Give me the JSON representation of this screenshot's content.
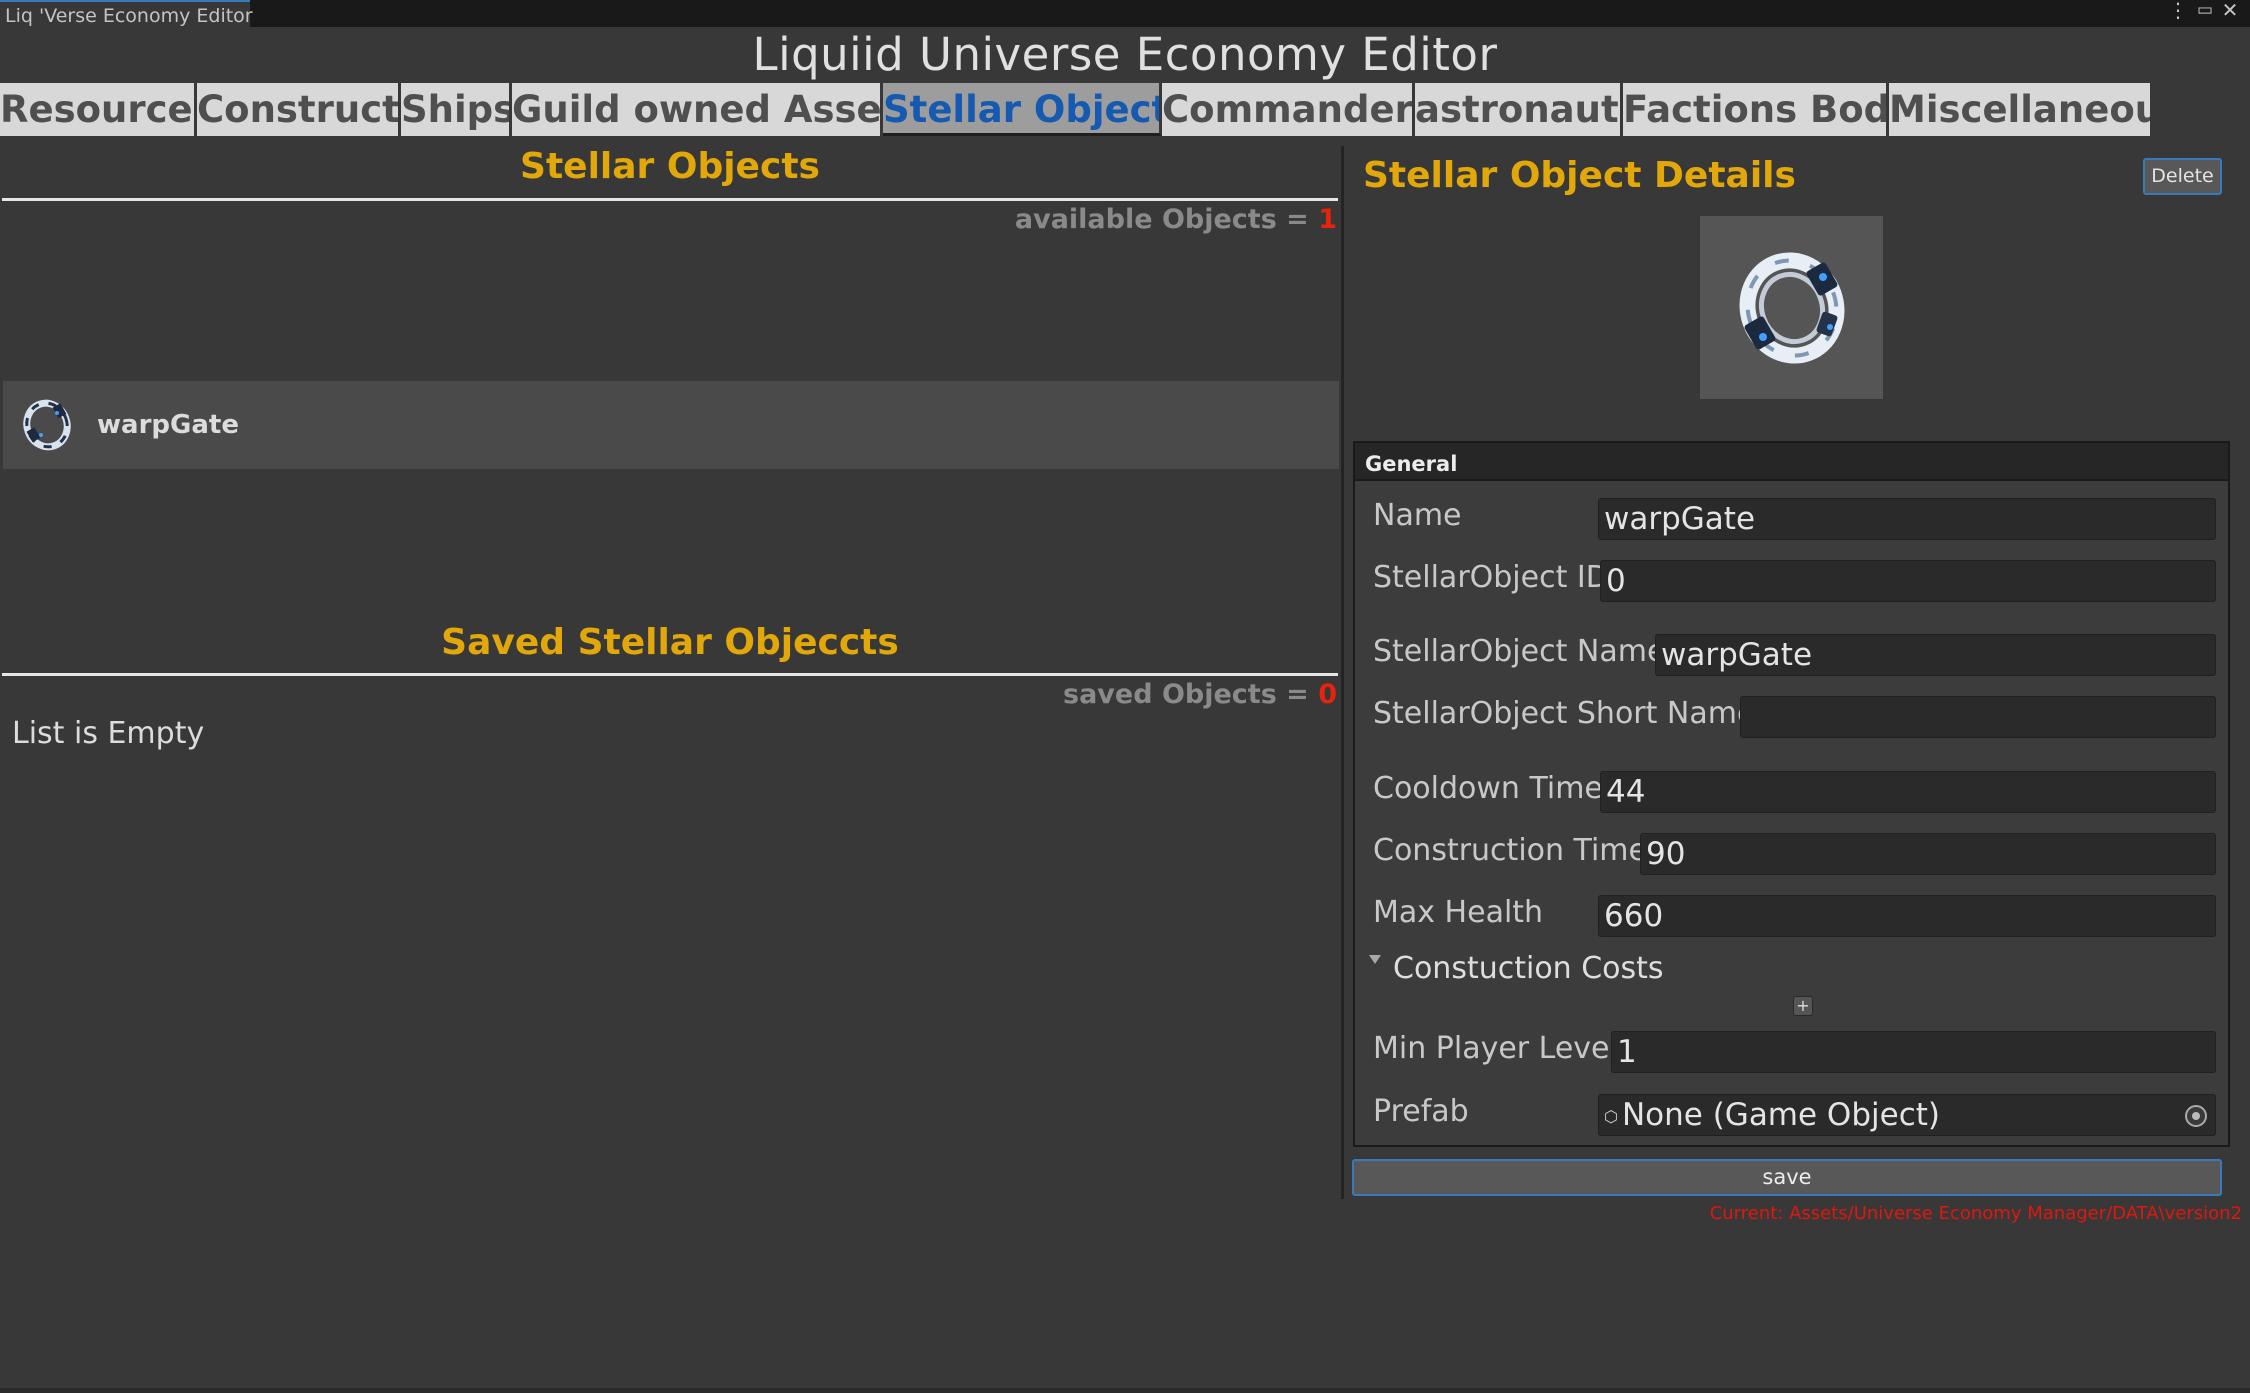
{
  "window": {
    "tab_title": "Liq 'Verse Economy Editor",
    "controls": [
      "more-icon",
      "maximize-icon",
      "close-icon"
    ]
  },
  "app": {
    "title": "Liquiid Universe Economy Editor"
  },
  "tabs": [
    {
      "label": "Resources"
    },
    {
      "label": "Constructables"
    },
    {
      "label": "Ships"
    },
    {
      "label": "Guild owned Assets"
    },
    {
      "label": "Stellar Objects",
      "active": true
    },
    {
      "label": "Commanders"
    },
    {
      "label": "astronauts"
    },
    {
      "label": "Factions Body"
    },
    {
      "label": "Miscellaneous"
    }
  ],
  "left": {
    "available_title": "Stellar Objects",
    "available_count_label": "available Objects = ",
    "available_count": "1",
    "items": [
      {
        "label": "warpGate",
        "icon": "warp-gate-icon"
      }
    ],
    "saved_title": "Saved Stellar Objeccts",
    "saved_count_label": "saved Objects = ",
    "saved_count": "0",
    "empty_text": "List is Empty"
  },
  "details": {
    "title": "Stellar Object Details",
    "delete_label": "Delete",
    "section": "General",
    "fields": {
      "name": {
        "label": "Name",
        "value": "warpGate"
      },
      "id": {
        "label": "StellarObject ID",
        "value": "0"
      },
      "object_name": {
        "label": "StellarObject Name",
        "value": "warpGate"
      },
      "short_name": {
        "label": "StellarObject Short Name",
        "value": ""
      },
      "cooldown": {
        "label": "Cooldown Time",
        "value": "44"
      },
      "construction": {
        "label": "Construction Time",
        "value": "90"
      },
      "max_health": {
        "label": "Max Health",
        "value": "660"
      },
      "costs": {
        "label": "Constuction Costs"
      },
      "min_level": {
        "label": "Min Player Level",
        "value": "1"
      },
      "prefab": {
        "label": "Prefab",
        "value": "None (Game Object)"
      }
    },
    "add_label": "+",
    "save_label": "save",
    "current_path": "Current: Assets/Universe Economy Manager/DATA\\version2"
  },
  "colors": {
    "accent_gold": "#e2a80a",
    "active_tab_text": "#1559b0",
    "count_red": "#e8230c",
    "button_border": "#3a79bb",
    "path_red": "#e0170d"
  }
}
